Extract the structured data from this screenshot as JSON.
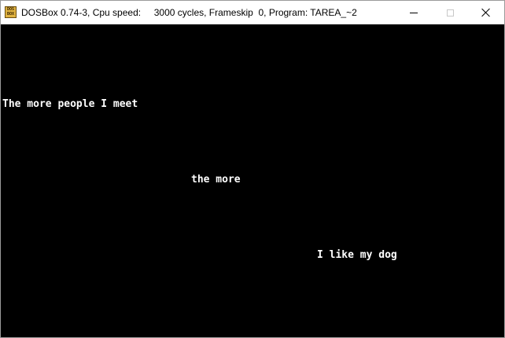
{
  "window": {
    "app_icon_text": "DOS BOX",
    "title": "DOSBox 0.74-3, Cpu speed:     3000 cycles, Frameskip  0, Program: TAREA_~2",
    "controls": {
      "minimize_icon": "minimize-icon",
      "maximize_icon": "maximize-icon",
      "close_icon": "close-icon"
    }
  },
  "screen": {
    "background": "#000000",
    "text_color": "#ffffff",
    "lines": [
      "The more people I meet",
      "the more",
      "I like my dog"
    ]
  }
}
